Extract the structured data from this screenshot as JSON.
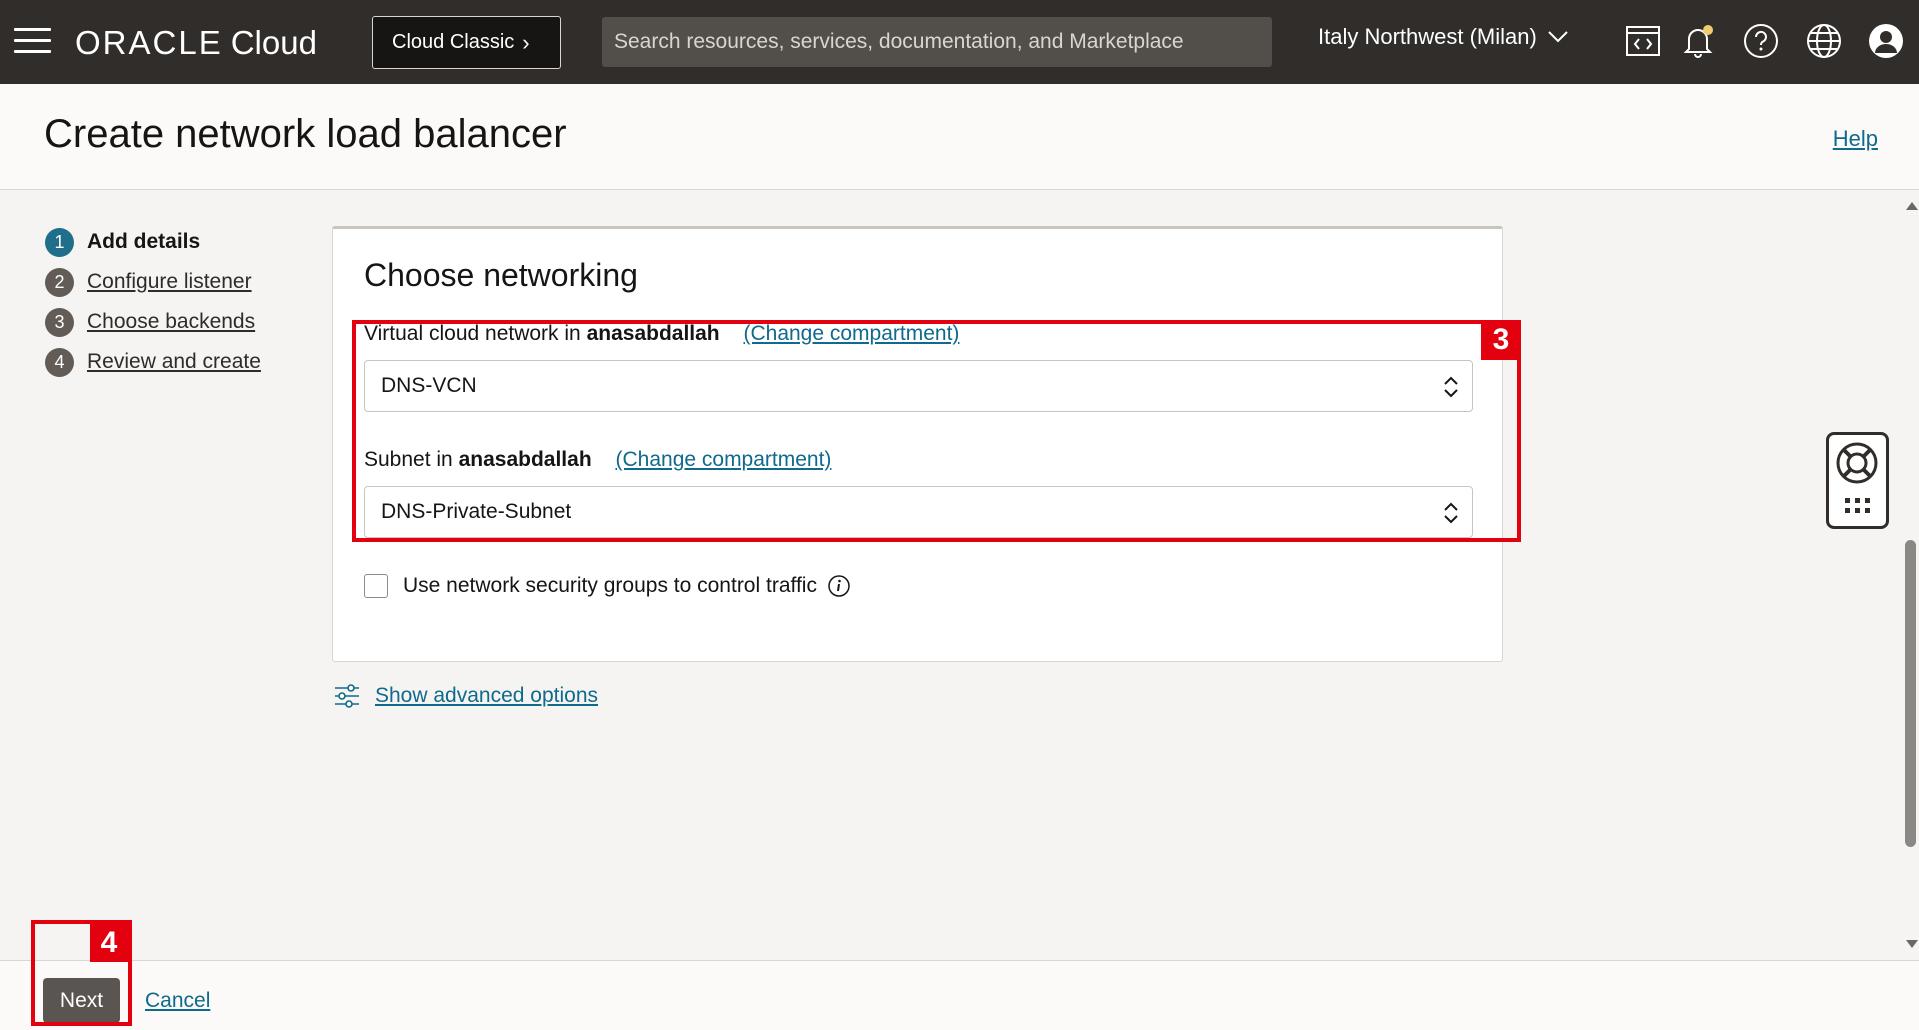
{
  "topbar": {
    "logo_brand": "ORACLE",
    "logo_product": "Cloud",
    "classic_label": "Cloud Classic",
    "search_placeholder": "Search resources, services, documentation, and Marketplace",
    "region": "Italy Northwest (Milan)",
    "icons": [
      "menu-icon",
      "code-editor-icon",
      "bell-icon",
      "help-icon",
      "globe-icon",
      "user-icon"
    ],
    "colors": {
      "bar": "#312d2a",
      "search": "#524e4a"
    }
  },
  "header": {
    "title": "Create network load balancer",
    "help_label": "Help"
  },
  "steps": [
    {
      "number": "1",
      "label": "Add details",
      "active": true
    },
    {
      "number": "2",
      "label": "Configure listener",
      "active": false
    },
    {
      "number": "3",
      "label": "Choose backends",
      "active": false
    },
    {
      "number": "4",
      "label": "Review and create",
      "active": false
    }
  ],
  "networking": {
    "title": "Choose networking",
    "vcn": {
      "label_prefix": "Virtual cloud network in",
      "compartment": "anasabdallah",
      "change_label": "(Change compartment)",
      "value": "DNS-VCN"
    },
    "subnet": {
      "label_prefix": "Subnet in",
      "compartment": "anasabdallah",
      "change_label": "(Change compartment)",
      "value": "DNS-Private-Subnet"
    },
    "nsg_label": "Use network security groups to control traffic",
    "nsg_checked": false
  },
  "advanced_label": "Show advanced options",
  "annotations": {
    "badge_networking": "3",
    "badge_next": "4",
    "color": "#e3000f"
  },
  "footer": {
    "next_label": "Next",
    "cancel_label": "Cancel"
  }
}
